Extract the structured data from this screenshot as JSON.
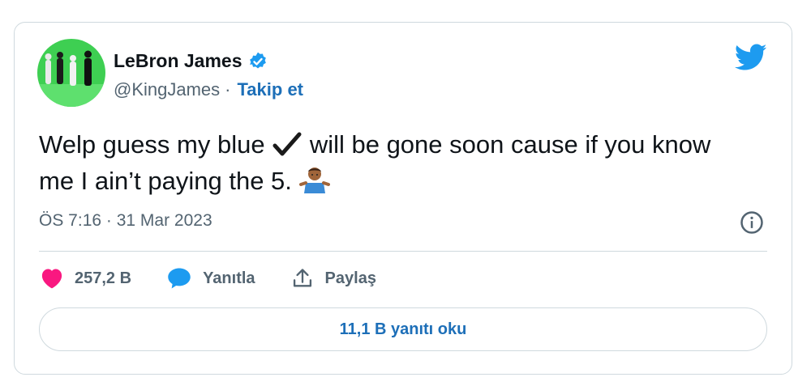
{
  "author": {
    "name": "LeBron James",
    "handle": "@KingJames",
    "separator": "·",
    "follow_label": "Takip et"
  },
  "tweet": {
    "text_part1": "Welp guess my blue",
    "text_part2": "will be gone soon cause if you know me I ain’t paying the 5.",
    "timestamp": "ÖS 7:16 · 31 Mar 2023"
  },
  "actions": {
    "likes": "257,2 B",
    "reply_label": "Yanıtla",
    "share_label": "Paylaş"
  },
  "replies_button": {
    "label": "11,1 B yanıtı oku"
  },
  "icons": {
    "verified": "verified-badge-icon",
    "brand": "twitter-bird-icon",
    "info": "info-icon",
    "like": "heart-icon",
    "reply": "reply-bubble-icon",
    "share": "share-upload-icon",
    "check": "checkmark-icon",
    "shrug": "shrug-emoji-icon"
  },
  "colors": {
    "accent": "#1d9bf0",
    "like": "#f91880",
    "text": "#0f1419",
    "secondary": "#536471",
    "border": "#cfd9de"
  }
}
